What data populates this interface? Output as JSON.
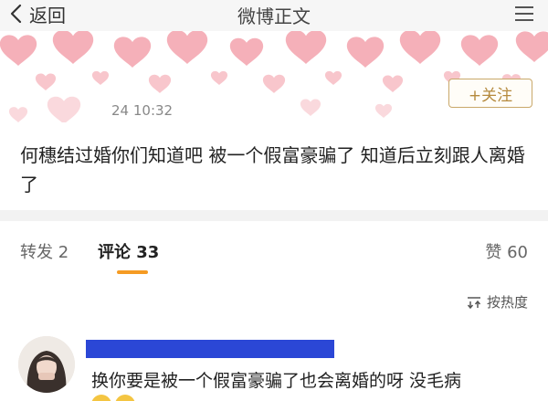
{
  "nav": {
    "back_label": "返回",
    "title": "微博正文"
  },
  "post": {
    "follow_label": "+关注",
    "time": "24 10:32",
    "text": "何穗结过婚你们知道吧  被一个假富豪骗了  知道后立刻跟人离婚了"
  },
  "tabs": {
    "repost": "转发 2",
    "comments": "评论 33",
    "likes": "赞 60"
  },
  "sort": {
    "label": "按热度"
  },
  "comment": {
    "text": "换你要是被一个假富豪骗了也会离婚的呀 没毛病"
  },
  "colors": {
    "accent": "#f59b23",
    "follow": "#b58a3e",
    "redaction": "#2b47d6",
    "hearts": "#f4a3ad"
  }
}
